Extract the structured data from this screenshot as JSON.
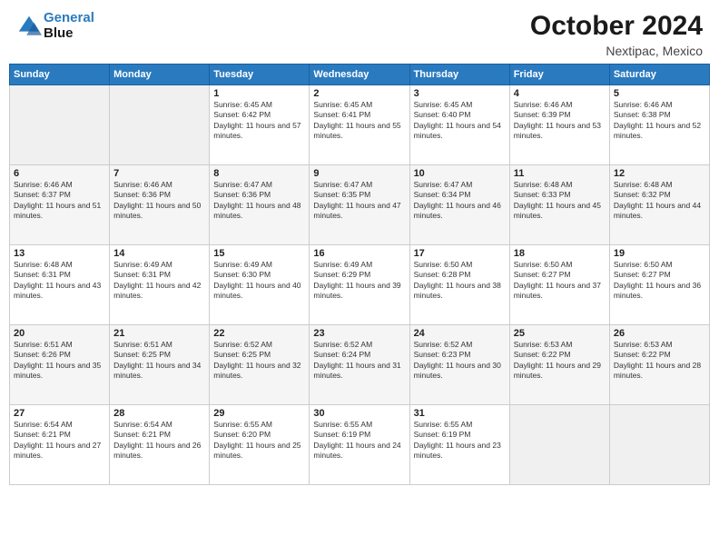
{
  "header": {
    "logo_line1": "General",
    "logo_line2": "Blue",
    "month": "October 2024",
    "location": "Nextipac, Mexico"
  },
  "weekdays": [
    "Sunday",
    "Monday",
    "Tuesday",
    "Wednesday",
    "Thursday",
    "Friday",
    "Saturday"
  ],
  "weeks": [
    [
      {
        "day": "",
        "info": ""
      },
      {
        "day": "",
        "info": ""
      },
      {
        "day": "1",
        "info": "Sunrise: 6:45 AM\nSunset: 6:42 PM\nDaylight: 11 hours and 57 minutes."
      },
      {
        "day": "2",
        "info": "Sunrise: 6:45 AM\nSunset: 6:41 PM\nDaylight: 11 hours and 55 minutes."
      },
      {
        "day": "3",
        "info": "Sunrise: 6:45 AM\nSunset: 6:40 PM\nDaylight: 11 hours and 54 minutes."
      },
      {
        "day": "4",
        "info": "Sunrise: 6:46 AM\nSunset: 6:39 PM\nDaylight: 11 hours and 53 minutes."
      },
      {
        "day": "5",
        "info": "Sunrise: 6:46 AM\nSunset: 6:38 PM\nDaylight: 11 hours and 52 minutes."
      }
    ],
    [
      {
        "day": "6",
        "info": "Sunrise: 6:46 AM\nSunset: 6:37 PM\nDaylight: 11 hours and 51 minutes."
      },
      {
        "day": "7",
        "info": "Sunrise: 6:46 AM\nSunset: 6:36 PM\nDaylight: 11 hours and 50 minutes."
      },
      {
        "day": "8",
        "info": "Sunrise: 6:47 AM\nSunset: 6:36 PM\nDaylight: 11 hours and 48 minutes."
      },
      {
        "day": "9",
        "info": "Sunrise: 6:47 AM\nSunset: 6:35 PM\nDaylight: 11 hours and 47 minutes."
      },
      {
        "day": "10",
        "info": "Sunrise: 6:47 AM\nSunset: 6:34 PM\nDaylight: 11 hours and 46 minutes."
      },
      {
        "day": "11",
        "info": "Sunrise: 6:48 AM\nSunset: 6:33 PM\nDaylight: 11 hours and 45 minutes."
      },
      {
        "day": "12",
        "info": "Sunrise: 6:48 AM\nSunset: 6:32 PM\nDaylight: 11 hours and 44 minutes."
      }
    ],
    [
      {
        "day": "13",
        "info": "Sunrise: 6:48 AM\nSunset: 6:31 PM\nDaylight: 11 hours and 43 minutes."
      },
      {
        "day": "14",
        "info": "Sunrise: 6:49 AM\nSunset: 6:31 PM\nDaylight: 11 hours and 42 minutes."
      },
      {
        "day": "15",
        "info": "Sunrise: 6:49 AM\nSunset: 6:30 PM\nDaylight: 11 hours and 40 minutes."
      },
      {
        "day": "16",
        "info": "Sunrise: 6:49 AM\nSunset: 6:29 PM\nDaylight: 11 hours and 39 minutes."
      },
      {
        "day": "17",
        "info": "Sunrise: 6:50 AM\nSunset: 6:28 PM\nDaylight: 11 hours and 38 minutes."
      },
      {
        "day": "18",
        "info": "Sunrise: 6:50 AM\nSunset: 6:27 PM\nDaylight: 11 hours and 37 minutes."
      },
      {
        "day": "19",
        "info": "Sunrise: 6:50 AM\nSunset: 6:27 PM\nDaylight: 11 hours and 36 minutes."
      }
    ],
    [
      {
        "day": "20",
        "info": "Sunrise: 6:51 AM\nSunset: 6:26 PM\nDaylight: 11 hours and 35 minutes."
      },
      {
        "day": "21",
        "info": "Sunrise: 6:51 AM\nSunset: 6:25 PM\nDaylight: 11 hours and 34 minutes."
      },
      {
        "day": "22",
        "info": "Sunrise: 6:52 AM\nSunset: 6:25 PM\nDaylight: 11 hours and 32 minutes."
      },
      {
        "day": "23",
        "info": "Sunrise: 6:52 AM\nSunset: 6:24 PM\nDaylight: 11 hours and 31 minutes."
      },
      {
        "day": "24",
        "info": "Sunrise: 6:52 AM\nSunset: 6:23 PM\nDaylight: 11 hours and 30 minutes."
      },
      {
        "day": "25",
        "info": "Sunrise: 6:53 AM\nSunset: 6:22 PM\nDaylight: 11 hours and 29 minutes."
      },
      {
        "day": "26",
        "info": "Sunrise: 6:53 AM\nSunset: 6:22 PM\nDaylight: 11 hours and 28 minutes."
      }
    ],
    [
      {
        "day": "27",
        "info": "Sunrise: 6:54 AM\nSunset: 6:21 PM\nDaylight: 11 hours and 27 minutes."
      },
      {
        "day": "28",
        "info": "Sunrise: 6:54 AM\nSunset: 6:21 PM\nDaylight: 11 hours and 26 minutes."
      },
      {
        "day": "29",
        "info": "Sunrise: 6:55 AM\nSunset: 6:20 PM\nDaylight: 11 hours and 25 minutes."
      },
      {
        "day": "30",
        "info": "Sunrise: 6:55 AM\nSunset: 6:19 PM\nDaylight: 11 hours and 24 minutes."
      },
      {
        "day": "31",
        "info": "Sunrise: 6:55 AM\nSunset: 6:19 PM\nDaylight: 11 hours and 23 minutes."
      },
      {
        "day": "",
        "info": ""
      },
      {
        "day": "",
        "info": ""
      }
    ]
  ]
}
